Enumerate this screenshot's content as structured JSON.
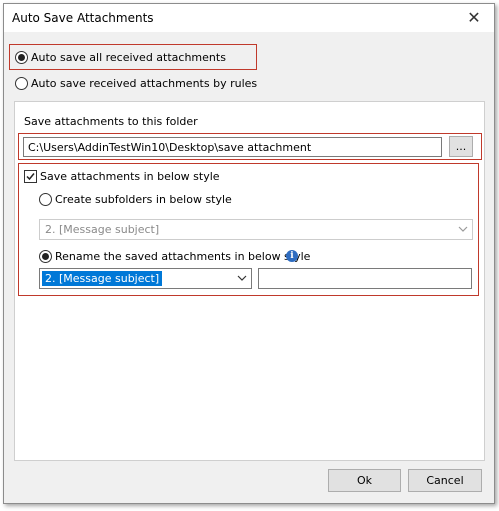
{
  "window": {
    "title": "Auto Save Attachments",
    "close_glyph": "✕"
  },
  "options": {
    "all_label": "Auto save all received attachments",
    "rules_label": "Auto save received attachments by rules",
    "selected": "all"
  },
  "folder": {
    "label": "Save attachments to this folder",
    "path": "C:\\Users\\AddinTestWin10\\Desktop\\save attachment",
    "browse_label": "..."
  },
  "style": {
    "checkbox_label": "Save attachments in below style",
    "checked": true,
    "subfolders_label": "Create subfolders in below style",
    "subfolders_value": "2. [Message subject]",
    "rename_label": "Rename the saved attachments in below style",
    "rename_value": "2. [Message subject]",
    "rename_extra": "",
    "selected": "rename",
    "info_glyph": "i"
  },
  "buttons": {
    "ok": "Ok",
    "cancel": "Cancel"
  },
  "colors": {
    "highlight": "#c0392b",
    "accent": "#0078d7"
  }
}
